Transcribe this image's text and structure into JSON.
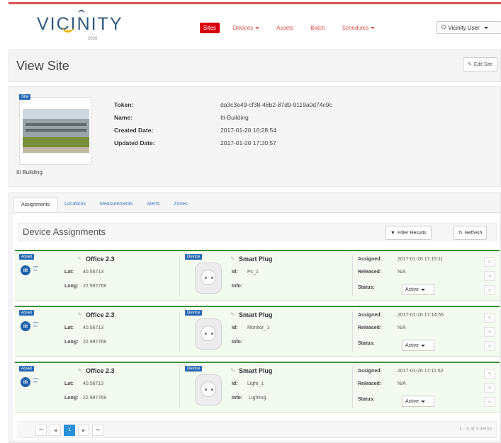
{
  "app": {
    "logo": "VICINITY",
    "logo_sub": "2020",
    "nav": [
      {
        "label": "Sites",
        "active": true,
        "dropdown": false
      },
      {
        "label": "Devices",
        "active": false,
        "dropdown": true
      },
      {
        "label": "Assets",
        "active": false,
        "dropdown": false
      },
      {
        "label": "Batch",
        "active": false,
        "dropdown": false
      },
      {
        "label": "Schedules",
        "active": false,
        "dropdown": true
      }
    ],
    "user_label": "Vicinity User",
    "accent_color": "#d9000d"
  },
  "page": {
    "title": "View Site",
    "edit_label": "Edit Site"
  },
  "site": {
    "badge": "Site",
    "caption": "Iti Building",
    "fields": [
      {
        "label": "Token:",
        "value": "da3c3e49-cf38-46b2-87d9-9119a0d74c9c"
      },
      {
        "label": "Name:",
        "value": "Iti-Building"
      },
      {
        "label": "Created Date:",
        "value": "2017-01-20 16:28:54"
      },
      {
        "label": "Updated Date:",
        "value": "2017-01-20 17:20:57"
      }
    ]
  },
  "tabs": [
    "Assignments",
    "Locations",
    "Measurements",
    "Alerts",
    "Zones"
  ],
  "assignments": {
    "title": "Device Assignments",
    "filter_label": "Filter Results",
    "refresh_label": "Refresh",
    "labels": {
      "asset_badge": "Asset",
      "device_badge": "Device",
      "lat": "Lat:",
      "long": "Long:",
      "id": "Id:",
      "info": "Info:",
      "assigned": "Assigned:",
      "released": "Released:",
      "status": "Status:"
    },
    "items": [
      {
        "asset": "Office 2.3",
        "lat": "40.56713",
        "long": "22.997769",
        "device": "Smart Plug",
        "id": "Pc_1",
        "info": "",
        "assigned": "2017-01-20 17:15:11",
        "released": "N/A",
        "status": "Active"
      },
      {
        "asset": "Office 2.3",
        "lat": "40.56713",
        "long": "22.997769",
        "device": "Smart Plug",
        "id": "Monitor_1",
        "info": "",
        "assigned": "2017-01-20 17:14:55",
        "released": "N/A",
        "status": "Active"
      },
      {
        "asset": "Office 2.3",
        "lat": "40.56713",
        "long": "22.997769",
        "device": "Smart Plug",
        "id": "Light_1",
        "info": "Lighting",
        "assigned": "2017-01-20 17:11:52",
        "released": "N/A",
        "status": "Active"
      }
    ],
    "pager": {
      "current_page": "1",
      "info": "1 - 3 of 3 items"
    }
  }
}
